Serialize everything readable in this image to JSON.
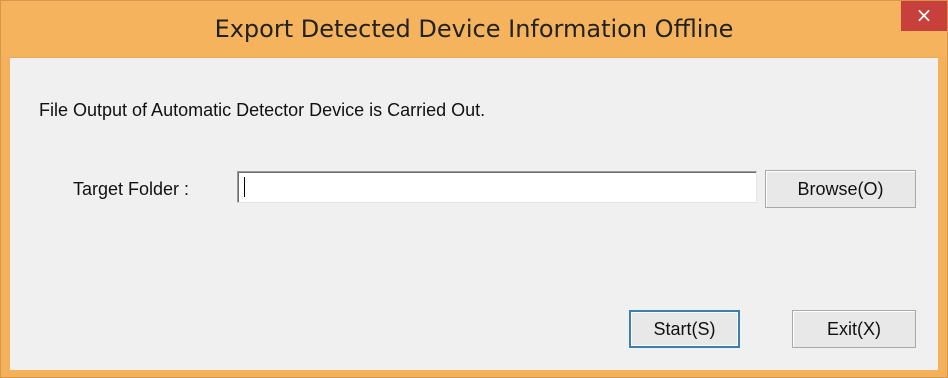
{
  "window": {
    "title": "Export Detected Device Information Offline",
    "close_glyph": "×"
  },
  "content": {
    "message": "File Output of Automatic Detector Device is Carried Out.",
    "target_folder_label": "Target Folder  :",
    "target_folder_value": ""
  },
  "buttons": {
    "browse_label": "Browse(O)",
    "start_label": "Start(S)",
    "exit_label": "Exit(X)"
  },
  "colors": {
    "titlebar": "#f4b35c",
    "client_background": "#f0f0f0",
    "close_button": "#c7403b",
    "default_button_border": "#3c7fb1"
  }
}
